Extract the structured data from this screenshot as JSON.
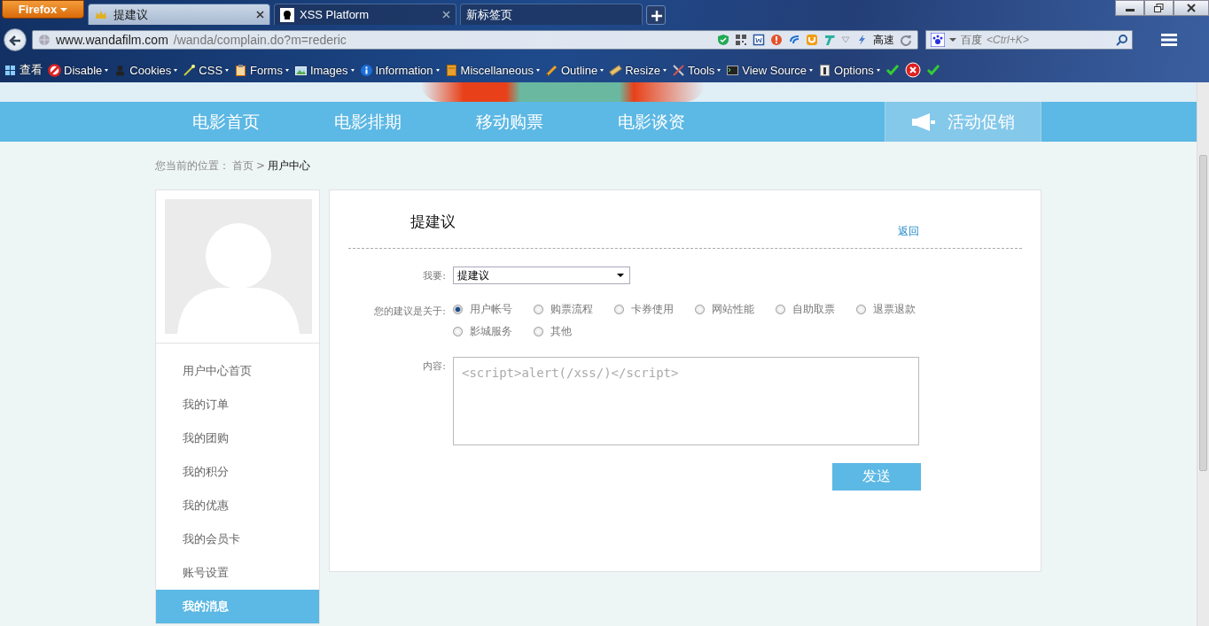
{
  "browser": {
    "menu_button": "Firefox",
    "tabs": [
      {
        "title": "提建议",
        "selected": true,
        "closable": true
      },
      {
        "title": "XSS Platform",
        "selected": false,
        "closable": true
      },
      {
        "title": "新标签页",
        "selected": false,
        "closable": false
      }
    ],
    "url": {
      "host": "www.wandafilm.com",
      "path": "/wanda/complain.do?m=rederic"
    },
    "speed_label": "高速",
    "search": {
      "engine": "百度",
      "placeholder": "<Ctrl+K>"
    },
    "toolbar": [
      {
        "label": "查看"
      },
      {
        "label": "Disable"
      },
      {
        "label": "Cookies"
      },
      {
        "label": "CSS"
      },
      {
        "label": "Forms"
      },
      {
        "label": "Images"
      },
      {
        "label": "Information"
      },
      {
        "label": "Miscellaneous"
      },
      {
        "label": "Outline"
      },
      {
        "label": "Resize"
      },
      {
        "label": "Tools"
      },
      {
        "label": "View Source"
      },
      {
        "label": "Options"
      }
    ]
  },
  "site_nav": [
    {
      "label": "电影首页",
      "selected": false
    },
    {
      "label": "电影排期",
      "selected": false
    },
    {
      "label": "移动购票",
      "selected": false
    },
    {
      "label": "电影谈资",
      "selected": false
    },
    {
      "label": "活动促销",
      "selected": true
    }
  ],
  "breadcrumb": {
    "prefix": "您当前的位置：",
    "home": "首页",
    "separator": ">",
    "current": "用户中心"
  },
  "sidebar": [
    {
      "label": "用户中心首页",
      "selected": false
    },
    {
      "label": "我的订单",
      "selected": false
    },
    {
      "label": "我的团购",
      "selected": false
    },
    {
      "label": "我的积分",
      "selected": false
    },
    {
      "label": "我的优惠",
      "selected": false
    },
    {
      "label": "我的会员卡",
      "selected": false
    },
    {
      "label": "账号设置",
      "selected": false
    },
    {
      "label": "我的消息",
      "selected": true
    }
  ],
  "form": {
    "title": "提建议",
    "back_link": "返回",
    "type_label": "我要:",
    "type_value": "提建议",
    "topic_label": "您的建议是关于:",
    "topics": [
      {
        "label": "用户帐号",
        "selected": true
      },
      {
        "label": "购票流程",
        "selected": false
      },
      {
        "label": "卡券使用",
        "selected": false
      },
      {
        "label": "网站性能",
        "selected": false
      },
      {
        "label": "自助取票",
        "selected": false
      },
      {
        "label": "退票退款",
        "selected": false
      },
      {
        "label": "影城服务",
        "selected": false
      },
      {
        "label": "其他",
        "selected": false
      }
    ],
    "content_label": "内容:",
    "content_value": "<script>alert(/xss/)</script>",
    "submit": "发送"
  }
}
